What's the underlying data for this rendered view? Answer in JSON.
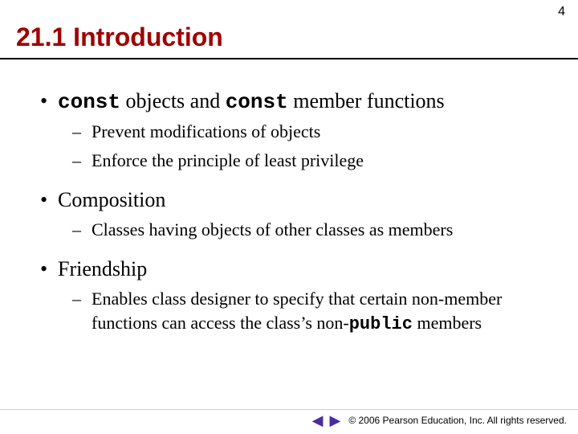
{
  "page_number": "4",
  "title": "21.1 Introduction",
  "bullets": {
    "b1": {
      "pre": "const",
      "mid": " objects and ",
      "mid2": "const",
      "post": " member functions",
      "sub1": "Prevent modifications of objects",
      "sub2": "Enforce the principle of least privilege"
    },
    "b2": {
      "text": "Composition",
      "sub1": "Classes having objects of other classes as members"
    },
    "b3": {
      "text": "Friendship",
      "sub1_pre": "Enables class designer to specify that certain non-member functions can access the class’s non-",
      "sub1_code": "public",
      "sub1_post": " members"
    }
  },
  "footer": {
    "copyright": "© 2006 Pearson Education, Inc.  All rights reserved.",
    "prev": "◀",
    "next": "▶"
  }
}
